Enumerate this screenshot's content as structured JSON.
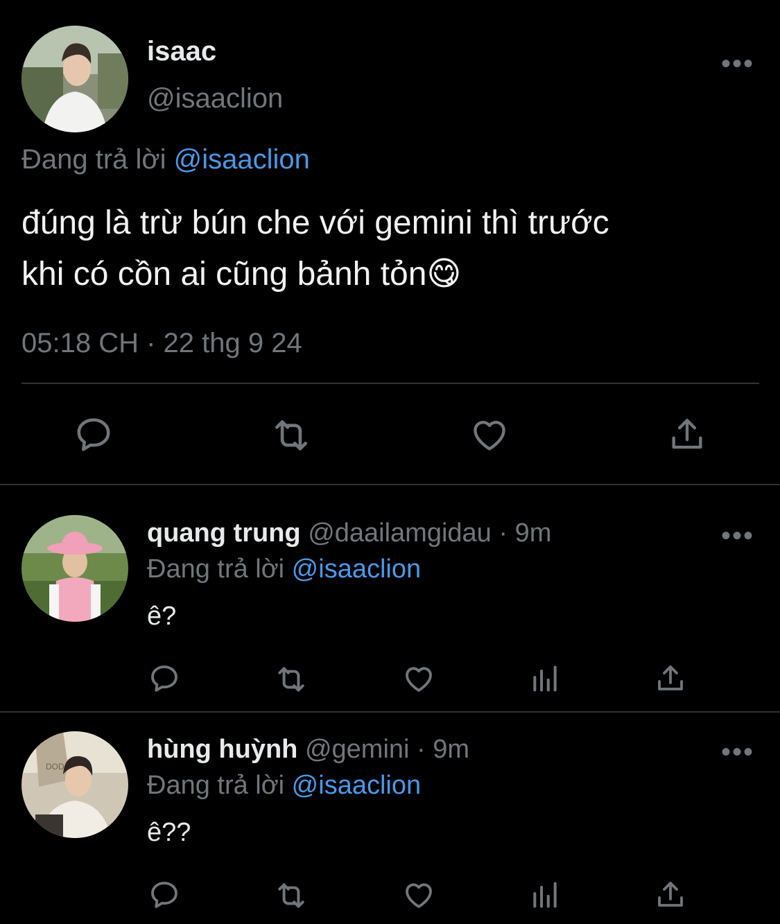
{
  "main_tweet": {
    "display_name": "isaac",
    "handle": "@isaaclion",
    "reply_prefix": "Đang trả lời",
    "reply_to": "@isaaclion",
    "text_line1": "đúng là trừ bún che với gemini thì trước",
    "text_line2": "khi có cồn ai cũng bảnh tỏn",
    "emoji": "😋",
    "timestamp": "05:18 CH · 22 thg 9 24",
    "more": "•••"
  },
  "replies": [
    {
      "display_name": "quang trung",
      "handle": "@daailamgidau",
      "time": "· 9m",
      "reply_prefix": "Đang trả lời",
      "reply_to": "@isaaclion",
      "text": "ê?",
      "more": "•••"
    },
    {
      "display_name": "hùng huỳnh",
      "handle": "@gemini",
      "time": "· 9m",
      "reply_prefix": "Đang trả lời",
      "reply_to": "@isaaclion",
      "text": "ê??",
      "more": "•••"
    }
  ],
  "icons": {
    "reply": "reply-icon",
    "retweet": "retweet-icon",
    "like": "heart-icon",
    "analytics": "analytics-icon",
    "share": "share-icon",
    "more": "more-icon"
  },
  "colors": {
    "background": "#000000",
    "text": "#e7e9ea",
    "muted": "#71767b",
    "link": "#4a99e9",
    "divider": "#2f3336"
  }
}
